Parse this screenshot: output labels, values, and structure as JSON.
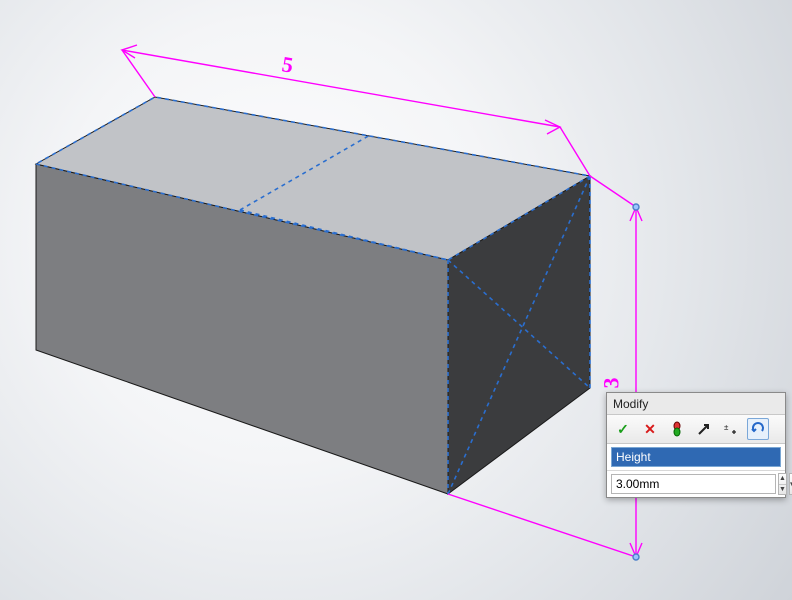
{
  "dimensions": {
    "length": {
      "value": "5"
    },
    "height": {
      "value": "3"
    }
  },
  "modify_panel": {
    "title": "Modify",
    "name_field": {
      "value": "Height"
    },
    "value_field": {
      "value": "3.00mm"
    },
    "toolbar": {
      "ok": "✓",
      "cancel": "✕"
    }
  },
  "colors": {
    "dimension": "#ff00ff",
    "sketch": "#2a6ecf",
    "face_top": "#c0c2c6",
    "face_front": "#7c7d80",
    "face_right": "#3a3b3d"
  }
}
